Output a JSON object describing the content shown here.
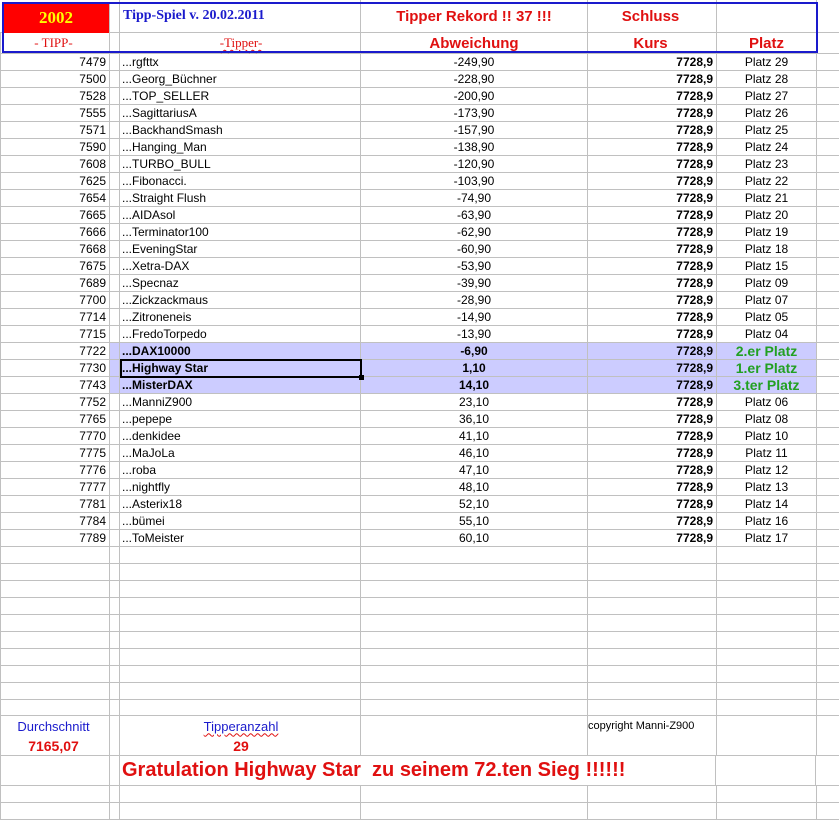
{
  "header": {
    "year": "2002",
    "title": "Tipp-Spiel v. 20.02.2011",
    "record": "Tipper Rekord !!  37  !!!",
    "schluss": "Schluss",
    "col_tipp": "- TIPP-",
    "col_tipper": "-Tipper-",
    "col_abw": "Abweichung",
    "col_kurs": "Kurs",
    "col_platz": "Platz"
  },
  "rows": [
    [
      "7479",
      "...rgfttx",
      "-249,90",
      "7728,9",
      "Platz 29"
    ],
    [
      "7500",
      "...Georg_Büchner",
      "-228,90",
      "7728,9",
      "Platz 28"
    ],
    [
      "7528",
      "...TOP_SELLER",
      "-200,90",
      "7728,9",
      "Platz 27"
    ],
    [
      "7555",
      "...SagittariusA",
      "-173,90",
      "7728,9",
      "Platz 26"
    ],
    [
      "7571",
      "...BackhandSmash",
      "-157,90",
      "7728,9",
      "Platz 25"
    ],
    [
      "7590",
      "...Hanging_Man",
      "-138,90",
      "7728,9",
      "Platz 24"
    ],
    [
      "7608",
      "...TURBO_BULL",
      "-120,90",
      "7728,9",
      "Platz 23"
    ],
    [
      "7625",
      "...Fibonacci.",
      "-103,90",
      "7728,9",
      "Platz 22"
    ],
    [
      "7654",
      "...Straight Flush",
      "-74,90",
      "7728,9",
      "Platz 21"
    ],
    [
      "7665",
      "...AIDAsol",
      "-63,90",
      "7728,9",
      "Platz 20"
    ],
    [
      "7666",
      "...Terminator100",
      "-62,90",
      "7728,9",
      "Platz 19"
    ],
    [
      "7668",
      "...EveningStar",
      "-60,90",
      "7728,9",
      "Platz 18"
    ],
    [
      "7675",
      "...Xetra-DAX",
      "-53,90",
      "7728,9",
      "Platz 15"
    ],
    [
      "7689",
      "...Specnaz",
      "-39,90",
      "7728,9",
      "Platz 09"
    ],
    [
      "7700",
      "...Zickzackmaus",
      "-28,90",
      "7728,9",
      "Platz 07"
    ],
    [
      "7714",
      "...Zitroneneis",
      "-14,90",
      "7728,9",
      "Platz 05"
    ],
    [
      "7715",
      "...FredoTorpedo",
      "-13,90",
      "7728,9",
      "Platz 04"
    ],
    [
      "7722",
      "...DAX10000",
      "-6,90",
      "7728,9",
      "2.er Platz"
    ],
    [
      "7730",
      "...Highway Star",
      "1,10",
      "7728,9",
      "1.er Platz"
    ],
    [
      "7743",
      "...MisterDAX",
      "14,10",
      "7728,9",
      "3.ter Platz"
    ],
    [
      "7752",
      "...ManniZ900",
      "23,10",
      "7728,9",
      "Platz 06"
    ],
    [
      "7765",
      "...pepepe",
      "36,10",
      "7728,9",
      "Platz 08"
    ],
    [
      "7770",
      "...denkidee",
      "41,10",
      "7728,9",
      "Platz 10"
    ],
    [
      "7775",
      "...MaJoLa",
      "46,10",
      "7728,9",
      "Platz 11"
    ],
    [
      "7776",
      "...roba",
      "47,10",
      "7728,9",
      "Platz 12"
    ],
    [
      "7777",
      "...nightfly",
      "48,10",
      "7728,9",
      "Platz 13"
    ],
    [
      "7781",
      "...Asterix18",
      "52,10",
      "7728,9",
      "Platz 14"
    ],
    [
      "7784",
      "...bümei",
      "55,10",
      "7728,9",
      "Platz 16"
    ],
    [
      "7789",
      "...ToMeister",
      "60,10",
      "7728,9",
      "Platz 17"
    ]
  ],
  "winners": [
    17,
    18,
    19
  ],
  "footer": {
    "avg_label": "Durchschnitt",
    "avg_value": "7165,07",
    "count_label": "Tipperanzahl",
    "count_value": "29",
    "copyright": "copyright Manni-Z900",
    "congrats": "Gratulation Highway Star  zu seinem 72.ten Sieg !!!!!!"
  },
  "colors": {
    "highlight": "#ccccff",
    "year_bg": "#ff0000",
    "year_text": "#ffff00",
    "winner": "#22a022",
    "header_red": "#e01010",
    "border_blue": "#1a1acc"
  }
}
